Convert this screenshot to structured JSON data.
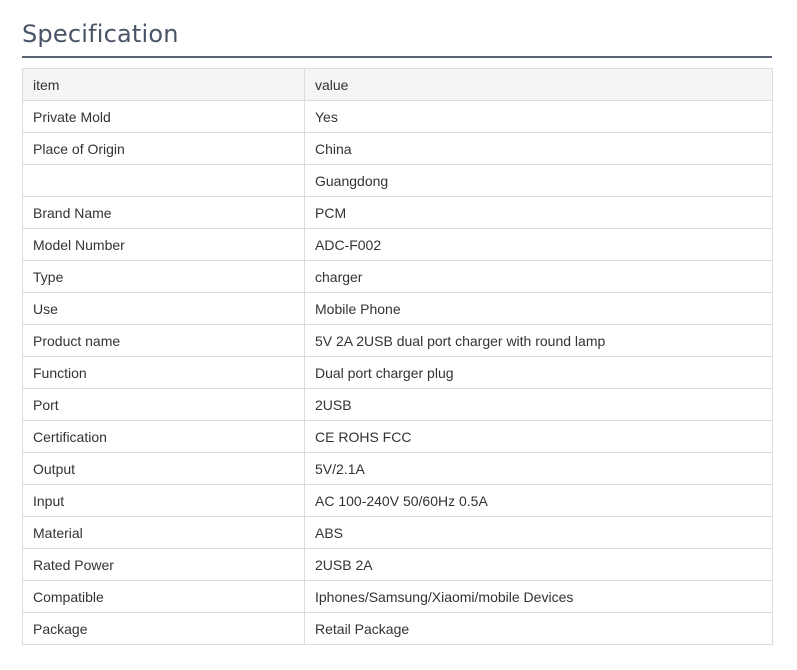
{
  "title": "Specification",
  "table": {
    "header": {
      "item": "item",
      "value": "value"
    },
    "rows": [
      {
        "item": "Private Mold",
        "value": "Yes"
      },
      {
        "item": "Place of Origin",
        "value": "China"
      },
      {
        "item": "",
        "value": "Guangdong"
      },
      {
        "item": "Brand Name",
        "value": "PCM"
      },
      {
        "item": "Model Number",
        "value": "ADC-F002"
      },
      {
        "item": "Type",
        "value": "charger"
      },
      {
        "item": "Use",
        "value": "Mobile Phone"
      },
      {
        "item": "Product name",
        "value": "5V 2A 2USB dual port charger with round lamp"
      },
      {
        "item": "Function",
        "value": "Dual port charger plug"
      },
      {
        "item": "Port",
        "value": "2USB"
      },
      {
        "item": "Certification",
        "value": "CE ROHS FCC"
      },
      {
        "item": "Output",
        "value": "5V/2.1A"
      },
      {
        "item": "Input",
        "value": "AC 100-240V 50/60Hz 0.5A"
      },
      {
        "item": "Material",
        "value": "ABS"
      },
      {
        "item": "Rated Power",
        "value": "2USB 2A"
      },
      {
        "item": "Compatible",
        "value": "Iphones/Samsung/Xiaomi/mobile Devices"
      },
      {
        "item": "Package",
        "value": "Retail Package"
      }
    ]
  },
  "colors": {
    "title": "#4a5468",
    "rule": "#5b6475",
    "border": "#dcdcdc",
    "header_bg": "#f5f5f5",
    "text": "#333333"
  }
}
